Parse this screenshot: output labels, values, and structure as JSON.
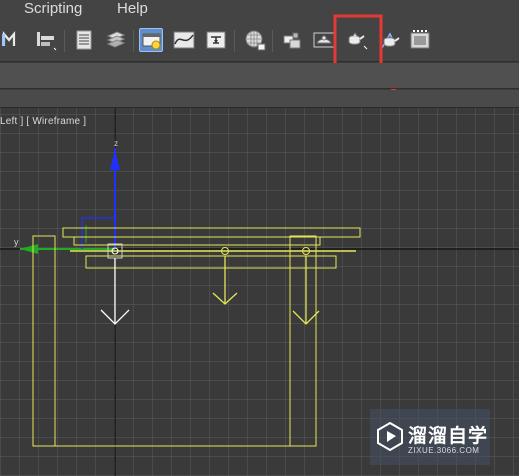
{
  "menu": {
    "items": [
      {
        "label": "Scripting"
      },
      {
        "label": "Help"
      }
    ]
  },
  "toolbar": {
    "icons": [
      "named-selection-icon",
      "align-icon",
      "scene-explorer-icon",
      "layer-manager-icon",
      "toggle-ribbon-icon",
      "curve-editor-icon",
      "schematic-view-icon",
      "material-editor-icon",
      "render-setup-icon",
      "rendered-frame-window-icon",
      "render-production-icon",
      "render-iterative-icon",
      "environment-icon"
    ],
    "highlight_color": "#e53935"
  },
  "viewport": {
    "label": "Left ] [ Wireframe ]",
    "grid_color": "#5a5a5a",
    "axis_x_label": "y",
    "axis_z_label": "z"
  },
  "watermark": {
    "title": "溜溜自学",
    "url": "ZIXUE.3066.COM"
  }
}
